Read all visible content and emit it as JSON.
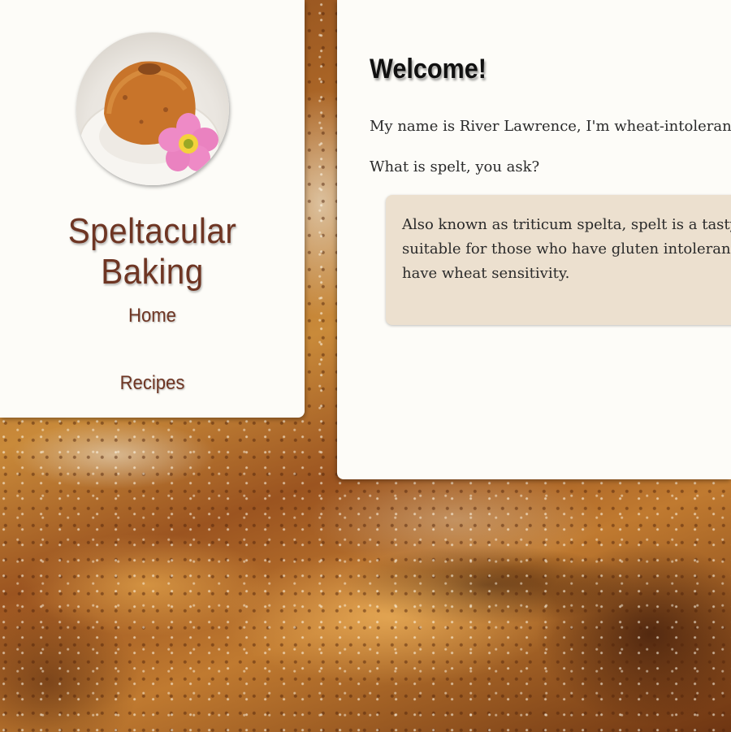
{
  "sidebar": {
    "site_title": "Speltacular Baking",
    "nav": [
      {
        "label": "Home"
      },
      {
        "label": "Recipes"
      }
    ]
  },
  "main": {
    "heading": "Welcome!",
    "intro": "My name is River Lawrence, I'm wheat-intolerant",
    "question": "What is spelt, you ask?",
    "quote": "Also known as triticum spelta, spelt is a tasty grain suitable for those who have gluten intolerance or have wheat sensitivity."
  },
  "colors": {
    "brand": "#6e3523",
    "panel": "#fdfcf8",
    "quote_bg": "#ece0cf"
  }
}
